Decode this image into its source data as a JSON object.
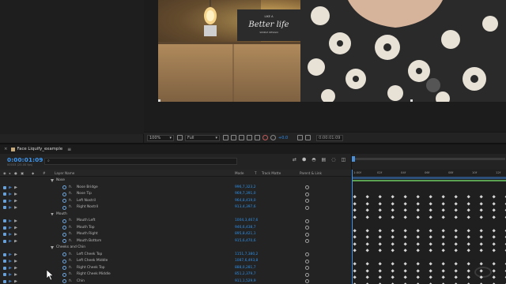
{
  "viewer": {
    "zoom": "100%",
    "resolution": "Full",
    "exposure": "+0.0",
    "time": "0:00:01:09",
    "box_text_line1": "Better life",
    "box_text_line2": "LIKE A",
    "box_text_line3": "SIMPLE DESIGN"
  },
  "timeline": {
    "tab_title": "Face Liquify_example",
    "timecode": "0:00:01:09",
    "fps_label": "00033 (25.00 fps)",
    "search_placeholder": "",
    "columns": {
      "layer_name": "Layer Name",
      "mode": "Mode",
      "t": "T",
      "track_matte": "Track Matte",
      "parent": "Parent & Link"
    },
    "ruler": [
      "1:00f",
      "02f",
      "04f",
      "06f",
      "08f",
      "10f",
      "12f"
    ],
    "rows": [
      {
        "type": "group",
        "label": "Nose"
      },
      {
        "type": "prop",
        "label": "Nose Bridge",
        "value": "996,7,323,2"
      },
      {
        "type": "prop",
        "label": "Nose Tip",
        "value": "969,7,391,0"
      },
      {
        "type": "prop",
        "label": "Left Nostril",
        "value": "964,8,419,0"
      },
      {
        "type": "prop",
        "label": "Right Nostril",
        "value": "913,4,397,6"
      },
      {
        "type": "group",
        "label": "Mouth"
      },
      {
        "type": "prop",
        "label": "Mouth Left",
        "value": "1004,3,467,6"
      },
      {
        "type": "prop",
        "label": "Mouth Top",
        "value": "946,6,438,7"
      },
      {
        "type": "prop",
        "label": "Mouth Right",
        "value": "895,8,421,1"
      },
      {
        "type": "prop",
        "label": "Mouth Bottom",
        "value": "915,6,470,6"
      },
      {
        "type": "group",
        "label": "Cheeks and Chin"
      },
      {
        "type": "prop",
        "label": "Left Cheek Top",
        "value": "1151,7,380,2"
      },
      {
        "type": "prop",
        "label": "Left Cheek Middle",
        "value": "1087,6,493,8"
      },
      {
        "type": "prop",
        "label": "Right Cheek Top",
        "value": "888,0,281,7"
      },
      {
        "type": "prop",
        "label": "Right Cheek Middle",
        "value": "851,2,379,7"
      },
      {
        "type": "prop",
        "label": "Chin",
        "value": "911,1,529,9"
      }
    ]
  },
  "colors": {
    "accent_blue": "#3d98f3",
    "keyframe": "#d7d7d7",
    "work_area": "#2c4f7a",
    "layer_bar": "#5ba352"
  },
  "icons": [
    "close-icon",
    "composition-icon",
    "panel-menu-icon",
    "search-icon",
    "stopwatch-icon",
    "path-icon",
    "pickwhip-icon",
    "eye-icon",
    "keyframe-icon",
    "cursor-icon",
    "camera-icon"
  ]
}
